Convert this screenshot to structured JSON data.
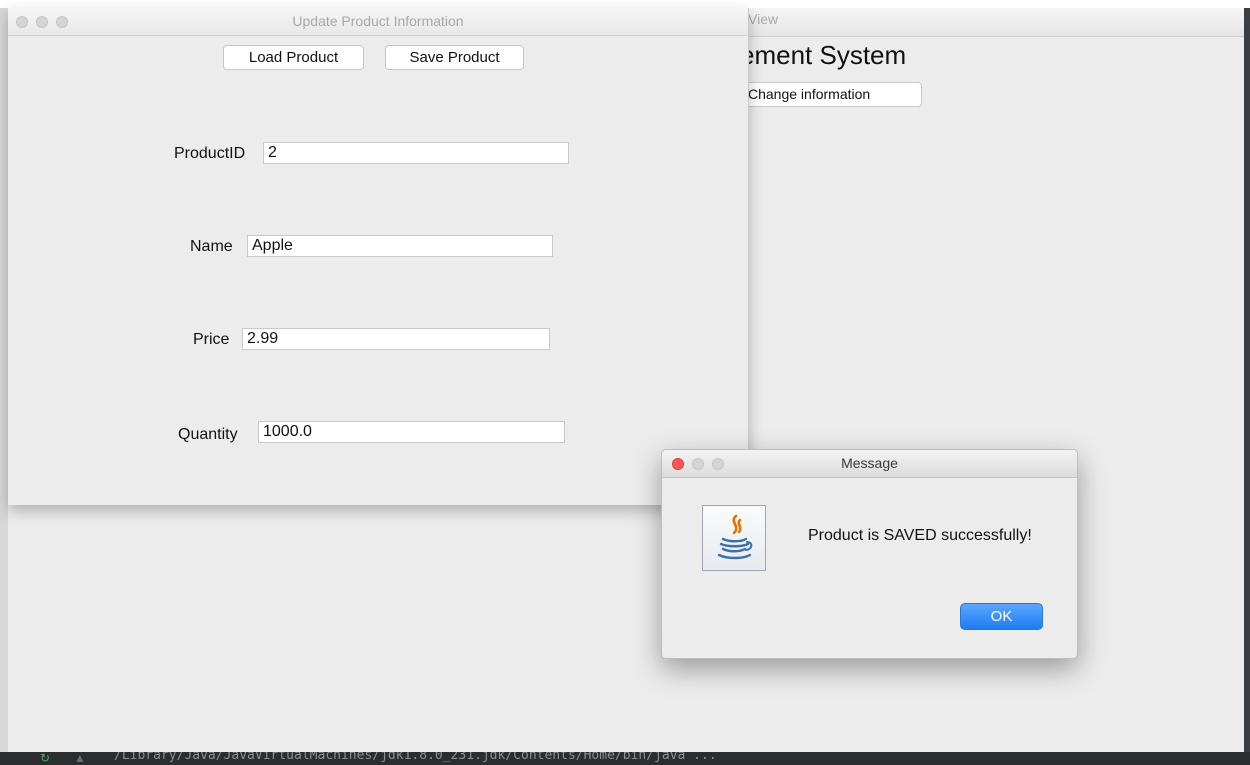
{
  "update_window": {
    "title": "Update Product Information",
    "buttons": {
      "load": "Load Product",
      "save": "Save Product"
    },
    "fields": {
      "product_id": {
        "label": "ProductID",
        "value": "2"
      },
      "name": {
        "label": "Name",
        "value": "Apple"
      },
      "price": {
        "label": "Price",
        "value": "2.99"
      },
      "quantity": {
        "label": "Quantity",
        "value": "1000.0"
      }
    }
  },
  "main_window": {
    "title_visible": "View",
    "heading_visible": "ement System",
    "change_info_button": "Change information"
  },
  "dialog": {
    "title": "Message",
    "message": "Product is SAVED successfully!",
    "ok_label": "OK",
    "icon": "java-coffee-cup-icon"
  },
  "console": {
    "text": "/Library/Java/JavaVirtualMachines/jdk1.8.0_231.jdk/Contents/Home/bin/java ..."
  },
  "colors": {
    "window_bg": "#ececec",
    "ok_button": "#1e7cf2",
    "close_red": "#fc5753",
    "ide_dark": "#2b2d30"
  }
}
